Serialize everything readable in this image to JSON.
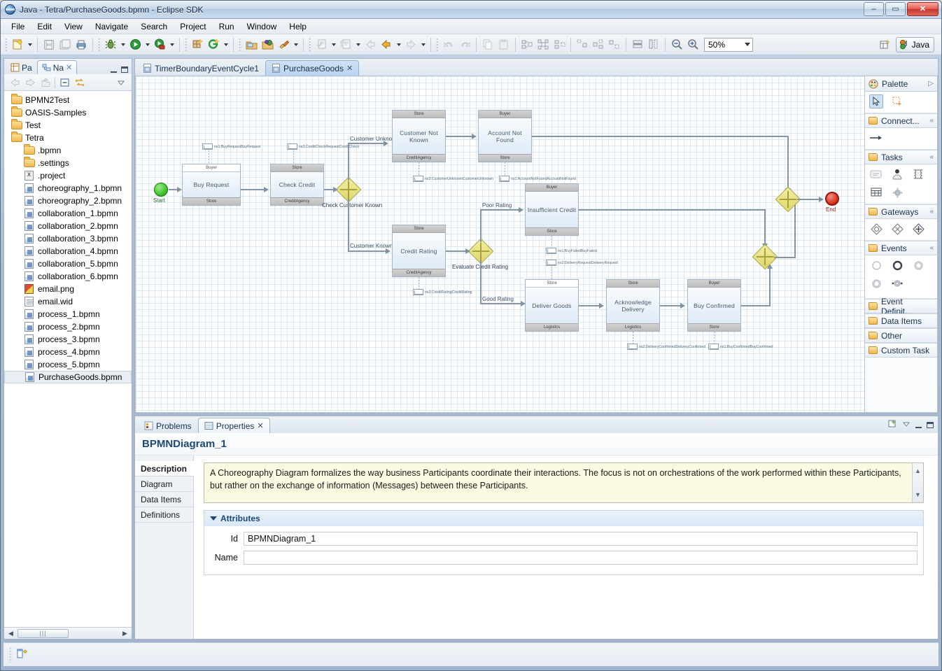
{
  "window": {
    "title": "Java - Tetra/PurchaseGoods.bpmn - Eclipse SDK",
    "minimize": "–",
    "maximize": "▭",
    "close": "✕"
  },
  "menubar": {
    "items": [
      "File",
      "Edit",
      "View",
      "Navigate",
      "Search",
      "Project",
      "Run",
      "Window",
      "Help"
    ]
  },
  "toolbar": {
    "zoom_level": "50%",
    "perspective_label": "Java",
    "icons": [
      "new-wizard-icon",
      "save-icon",
      "save-all-icon",
      "print-icon",
      "debug-icon",
      "run-icon",
      "run-external-tools-icon",
      "new-java-package-icon",
      "new-java-class-icon",
      "open-type-icon",
      "open-task-icon",
      "search-icon",
      "next-annotation-icon",
      "previous-annotation-icon",
      "back-icon",
      "forward-icon",
      "undo-icon",
      "redo-icon",
      "copy-icon",
      "paste-icon",
      "align-left-icon",
      "align-center-icon",
      "align-right-icon",
      "align-top-icon",
      "align-middle-icon",
      "align-bottom-icon",
      "match-width-icon",
      "match-height-icon",
      "zoom-out-icon",
      "zoom-in-icon"
    ]
  },
  "navigator": {
    "tabs": [
      {
        "label": "Pa",
        "icon": "package-explorer-icon",
        "active": false
      },
      {
        "label": "Na",
        "icon": "navigator-icon",
        "active": true,
        "closeable": true
      }
    ],
    "toolbar_icons": [
      "back-icon",
      "forward-icon",
      "up-icon",
      "collapse-all-icon",
      "link-with-editor-icon",
      "view-menu-icon"
    ],
    "tree": [
      {
        "label": "BPMN2Test",
        "icon": "folder-icon",
        "indent": 0,
        "type": "folder",
        "selected": false
      },
      {
        "label": "OASIS-Samples",
        "icon": "folder-icon",
        "indent": 0,
        "type": "folder",
        "selected": false
      },
      {
        "label": "Test",
        "icon": "folder-icon",
        "indent": 0,
        "type": "folder",
        "selected": false
      },
      {
        "label": "Tetra",
        "icon": "folder-icon",
        "indent": 0,
        "type": "folder",
        "selected": false
      },
      {
        "label": ".bpmn",
        "icon": "folder-icon",
        "indent": 1,
        "type": "folder",
        "selected": false
      },
      {
        "label": ".settings",
        "icon": "folder-icon",
        "indent": 1,
        "type": "folder",
        "selected": false
      },
      {
        "label": ".project",
        "icon": "project-file-icon",
        "indent": 1,
        "type": "proj",
        "selected": false
      },
      {
        "label": "choreography_1.bpmn",
        "icon": "bpmn-file-icon",
        "indent": 1,
        "type": "bpmn",
        "selected": false
      },
      {
        "label": "choreography_2.bpmn",
        "icon": "bpmn-file-icon",
        "indent": 1,
        "type": "bpmn",
        "selected": false
      },
      {
        "label": "collaboration_1.bpmn",
        "icon": "bpmn-file-icon",
        "indent": 1,
        "type": "bpmn",
        "selected": false
      },
      {
        "label": "collaboration_2.bpmn",
        "icon": "bpmn-file-icon",
        "indent": 1,
        "type": "bpmn",
        "selected": false
      },
      {
        "label": "collaboration_3.bpmn",
        "icon": "bpmn-file-icon",
        "indent": 1,
        "type": "bpmn",
        "selected": false
      },
      {
        "label": "collaboration_4.bpmn",
        "icon": "bpmn-file-icon",
        "indent": 1,
        "type": "bpmn",
        "selected": false
      },
      {
        "label": "collaboration_5.bpmn",
        "icon": "bpmn-file-icon",
        "indent": 1,
        "type": "bpmn",
        "selected": false
      },
      {
        "label": "collaboration_6.bpmn",
        "icon": "bpmn-file-icon",
        "indent": 1,
        "type": "bpmn",
        "selected": false
      },
      {
        "label": "email.png",
        "icon": "image-file-icon",
        "indent": 1,
        "type": "png",
        "selected": false
      },
      {
        "label": "email.wid",
        "icon": "text-file-icon",
        "indent": 1,
        "type": "wid",
        "selected": false
      },
      {
        "label": "process_1.bpmn",
        "icon": "bpmn-file-icon",
        "indent": 1,
        "type": "bpmn",
        "selected": false
      },
      {
        "label": "process_2.bpmn",
        "icon": "bpmn-file-icon",
        "indent": 1,
        "type": "bpmn",
        "selected": false
      },
      {
        "label": "process_3.bpmn",
        "icon": "bpmn-file-icon",
        "indent": 1,
        "type": "bpmn",
        "selected": false
      },
      {
        "label": "process_4.bpmn",
        "icon": "bpmn-file-icon",
        "indent": 1,
        "type": "bpmn",
        "selected": false
      },
      {
        "label": "process_5.bpmn",
        "icon": "bpmn-file-icon",
        "indent": 1,
        "type": "bpmn",
        "selected": false
      },
      {
        "label": "PurchaseGoods.bpmn",
        "icon": "bpmn-file-icon",
        "indent": 1,
        "type": "bpmn",
        "selected": true
      }
    ]
  },
  "editor": {
    "tabs": [
      {
        "label": "TimerBoundaryEventCycle1",
        "active": false,
        "closeable": false
      },
      {
        "label": "PurchaseGoods",
        "active": true,
        "closeable": true
      }
    ]
  },
  "palette": {
    "title": "Palette",
    "tools": [
      "select-tool-icon",
      "marquee-tool-icon"
    ],
    "drawers": [
      {
        "label": "Connect...",
        "items": [
          "sequence-flow-icon"
        ]
      },
      {
        "label": "Tasks",
        "items": [
          "abstract-task-icon",
          "user-task-icon",
          "script-task-icon",
          "manual-task-icon",
          "service-task-icon"
        ]
      },
      {
        "label": "Gateways",
        "items": [
          "exclusive-gateway-icon",
          "event-based-gateway-icon",
          "parallel-gateway-icon"
        ]
      },
      {
        "label": "Events",
        "items": [
          "start-event-icon",
          "end-event-icon",
          "intermediate-catch-event-icon",
          "intermediate-throw-event-icon",
          "boundary-event-icon"
        ]
      },
      {
        "label": "Event Definit...",
        "items": []
      },
      {
        "label": "Data Items",
        "items": []
      },
      {
        "label": "Other",
        "items": []
      },
      {
        "label": "Custom Task",
        "items": []
      }
    ]
  },
  "bottom": {
    "tabs": [
      {
        "label": "Problems",
        "icon": "problems-icon",
        "active": false,
        "closeable": false
      },
      {
        "label": "Properties",
        "icon": "properties-icon",
        "active": true,
        "closeable": true
      }
    ],
    "properties": {
      "header": "BPMNDiagram_1",
      "tabs": [
        "Description",
        "Diagram",
        "Data Items",
        "Definitions"
      ],
      "active_tab": "Description",
      "description": "A Choreography Diagram formalizes the way business Participants coordinate their interactions. The focus is not on orchestrations of the work performed within these Participants, but rather on the exchange of information (Messages) between these Participants.",
      "attributes_section_label": "Attributes",
      "fields": [
        {
          "label": "Id",
          "value": "BPMNDiagram_1"
        },
        {
          "label": "Name",
          "value": ""
        }
      ]
    }
  },
  "diagram": {
    "type": "bpmn-choreography",
    "events": [
      {
        "name": "Start",
        "label": "Start",
        "kind": "start"
      },
      {
        "name": "End",
        "label": "End",
        "kind": "end"
      }
    ],
    "gateways": [
      {
        "name": "check-customer-known-gateway",
        "label": "Check Customer Known"
      },
      {
        "name": "evaluate-credit-rating-gateway",
        "label": "Evaluate Credit Rating"
      },
      {
        "name": "merge-gateway-lower",
        "label": ""
      },
      {
        "name": "merge-gateway-upper",
        "label": ""
      }
    ],
    "tasks": [
      {
        "name": "Buy Request",
        "initiator": "Buyer",
        "participant": "Store"
      },
      {
        "name": "Check Credit",
        "initiator": "Store",
        "participant": "CreditAgency"
      },
      {
        "name": "Customer Not Known",
        "initiator": "Store",
        "participant": "CreditAgency"
      },
      {
        "name": "Account Not Found",
        "initiator": "Buyer",
        "participant": "Store"
      },
      {
        "name": "Credit Rating",
        "initiator": "Store",
        "participant": "CreditAgency"
      },
      {
        "name": "Insufficient Credit",
        "initiator": "Buyer",
        "participant": "Store"
      },
      {
        "name": "Deliver Goods",
        "initiator": "Store",
        "participant": "Logistics"
      },
      {
        "name": "Acknowledge Delivery",
        "initiator": "Store",
        "participant": "Logistics"
      },
      {
        "name": "Buy Confirmed",
        "initiator": "Buyer",
        "participant": "Store"
      }
    ],
    "flow_labels": [
      "Customer Unknown",
      "Customer Known",
      "Poor Rating",
      "Good Rating"
    ],
    "messages": [
      "ns1:BuyRequestBuyRequest",
      "ns3:CreditCheckRequestCreditCheck",
      "ns3:CustomerUnknownCustomerUnknown",
      "ns1:AccountNotFoundAccountNotFound",
      "ns3:CreditRatingCreditRating",
      "ns1:BuyFailedBuyFailed",
      "ns2:DeliveryRequestDeliveryRequest",
      "ns2:DeliveryConfirmedDeliveryConfirmed",
      "ns1:BuyConfirmedBuyConfirmed"
    ]
  },
  "statusbar": {
    "icon": "editor-status-icon",
    "text": ""
  }
}
